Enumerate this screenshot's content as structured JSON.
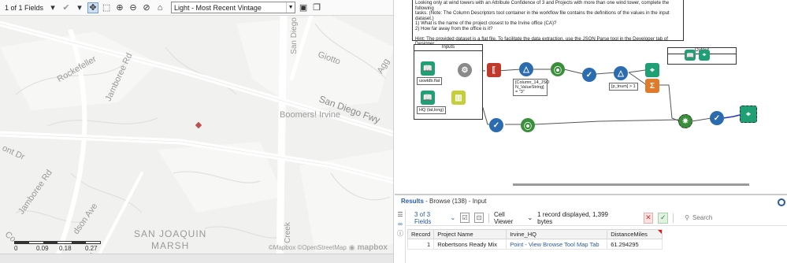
{
  "map_toolbar": {
    "fields_label": "1 of 1 Fields",
    "base_map_value": "Light - Most Recent Vintage"
  },
  "map": {
    "labels": {
      "rockefeller": "Rockefeller",
      "jamboree_1": "Jamboree Rd",
      "jamboree_2": "Jamboree Rd",
      "san_diego_vertical": "San Diego",
      "giotto": "Giotto",
      "agg": "Agg",
      "san_diego_fwy": "San Diego Fwy",
      "boomers": "Boomers! Irvine",
      "ont_dr": "ont Dr",
      "dson_ave": "dson Ave",
      "san_joaquin": "SAN JOAQUIN",
      "marsh": "MARSH",
      "creek": "Creek",
      "co": "Co"
    },
    "scale": {
      "labels": [
        "0",
        "0.09",
        "0.18",
        "0.27 mi"
      ]
    },
    "attribution": "©Mapbox ©OpenStreetMap",
    "logo_text": "mapbox",
    "point_color": "#c0504d"
  },
  "workflow": {
    "comment_lines": [
      "Looking only at wind towers with an Attribute Confidence of 3 and Projects with more than one wind tower, complete the following",
      "tasks. (Note: The Column Descriptors tool container in the workflow file contains the definitions of the values in the input dataset.)",
      "1) What is the name of the project closest to the Irvine office (CA)?",
      "2) How far away from the office is it?",
      "",
      "Hint: The provided dataset is a flat file. To facilitate the data extraction, use the JSON Parse tool in the Developer tab of Designer."
    ],
    "input_container_title": "Inputs",
    "output_container_title": "Output",
    "notes": {
      "uswtdb": "uswtdb.flat",
      "hq": "HQ (lat,long)",
      "filter1": "[Column_14_JSO N_ValueString] = \"3\"",
      "filter2": "[p_tnum] > 1"
    },
    "colors": {
      "input": "#1f9f74",
      "prep": "#2b8c4a",
      "join": "#2b6cb0",
      "parse": "#c0392b",
      "transform": "#e07b2c",
      "spatial": "#3a8f3a",
      "browse": "#1f9f74"
    }
  },
  "results": {
    "title_prefix": "Results",
    "title_rest": " - Browse (138) - Input",
    "fields_dropdown": "3 of 3 Fields",
    "viewer": "Cell Viewer",
    "status": "1 record displayed, 1,399 bytes",
    "search_placeholder": "Search",
    "columns": [
      "Record",
      "Project Name",
      "Irvine_HQ",
      "DistanceMiles"
    ],
    "rows": [
      [
        "1",
        "Robertsons Ready Mix",
        "Point - View Browse Tool Map Tab",
        "61.294295"
      ]
    ]
  }
}
